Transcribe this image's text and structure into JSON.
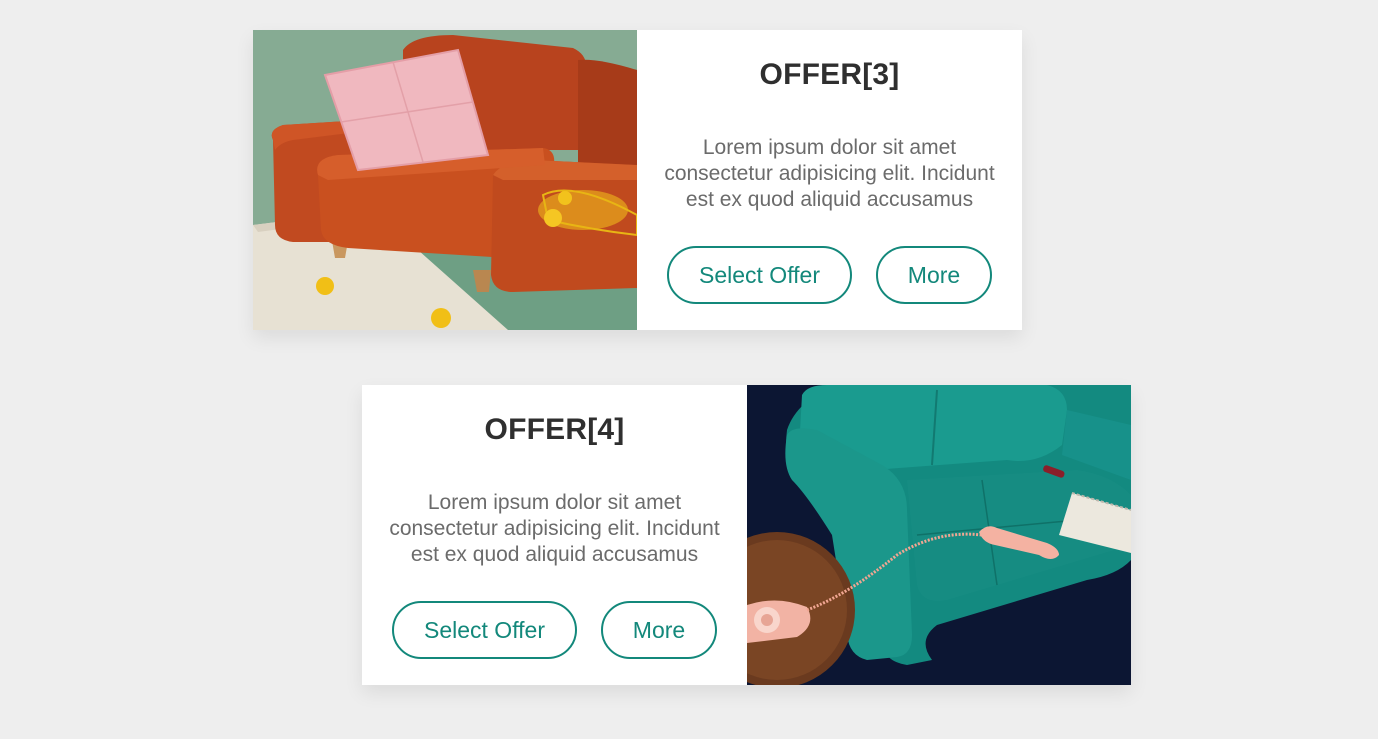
{
  "offers": [
    {
      "title": "OFFER[3]",
      "description": "Lorem ipsum dolor sit amet consectetur adipisicing elit. Incidunt est ex quod aliquid accusamus",
      "select_label": "Select Offer",
      "more_label": "More",
      "image_position": "left",
      "image_subject": "orange sofa with pink pillow and lemons"
    },
    {
      "title": "OFFER[4]",
      "description": "Lorem ipsum dolor sit amet consectetur adipisicing elit. Incidunt est ex quod aliquid accusamus",
      "select_label": "Select Offer",
      "more_label": "More",
      "image_position": "right",
      "image_subject": "teal velvet sofa with pink telephone"
    }
  ],
  "colors": {
    "page_background": "#eeeeee",
    "accent": "#13887b",
    "title_text": "#2f2f2f",
    "body_text": "#6b6b6b"
  }
}
